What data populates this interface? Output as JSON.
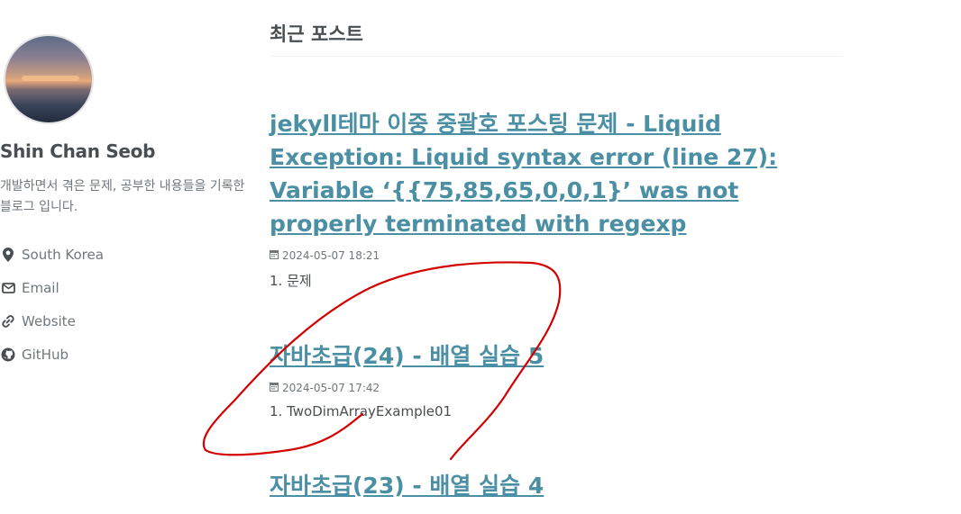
{
  "author": {
    "name": "Shin Chan Seob",
    "bio": "개발하면서 겪은 문제, 공부한 내용들을 기록한 블로그 입니다.",
    "links": [
      {
        "label": "South Korea",
        "icon": "location-pin-icon"
      },
      {
        "label": "Email",
        "icon": "envelope-icon"
      },
      {
        "label": "Website",
        "icon": "link-icon"
      },
      {
        "label": "GitHub",
        "icon": "github-icon"
      }
    ]
  },
  "main": {
    "title": "최근 포스트",
    "posts": [
      {
        "title": "jekyll테마 이중 중괄호 포스팅 문제 - Liquid Exception: Liquid syntax error (line 27): Variable ‘{{75,85,65,0,0,1}’ was not properly terminated with regexp",
        "date": "2024-05-07 18:21",
        "excerpt": "1. 문제"
      },
      {
        "title": "자바초급(24) - 배열 실습 5",
        "date": "2024-05-07 17:42",
        "excerpt": "1. TwoDimArrayExample01"
      },
      {
        "title": "자바초급(23) - 배열 실습 4",
        "date": "",
        "excerpt": ""
      }
    ]
  },
  "colors": {
    "link": "#4a8fa3",
    "text": "#494e52",
    "muted": "#6f777d",
    "annotation": "#d40000"
  }
}
